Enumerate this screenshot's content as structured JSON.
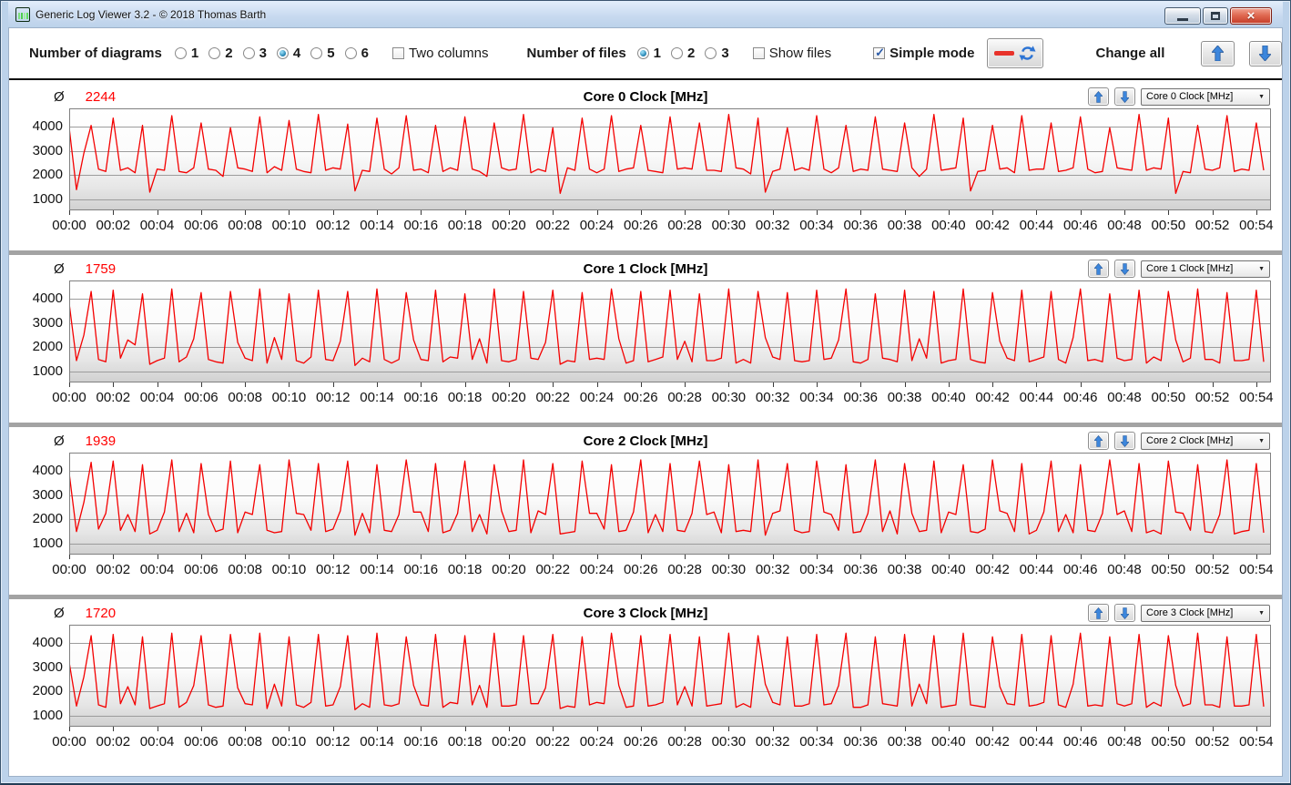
{
  "window": {
    "title": "Generic Log Viewer 3.2 - © 2018 Thomas Barth",
    "controls": [
      "minimize",
      "maximize",
      "close"
    ]
  },
  "toolbar": {
    "diagrams": {
      "label": "Number of diagrams",
      "options": [
        "1",
        "2",
        "3",
        "4",
        "5",
        "6"
      ],
      "selected": "4"
    },
    "two_columns": {
      "label": "Two columns",
      "checked": false
    },
    "files": {
      "label": "Number of files",
      "options": [
        "1",
        "2",
        "3"
      ],
      "selected": "1"
    },
    "show_files": {
      "label": "Show files",
      "checked": false
    },
    "simple_mode": {
      "label": "Simple mode",
      "checked": true
    },
    "refresh_button": {
      "icons": [
        "red-line-icon",
        "refresh-icon"
      ]
    },
    "change_all": {
      "label": "Change all",
      "buttons": [
        "up",
        "down"
      ]
    }
  },
  "labels": {
    "average_symbol": "Ø"
  },
  "colors": {
    "series": "#f40000",
    "average_value": "#ff0000",
    "grid": "#9c9c9c",
    "plot_border": "#808080",
    "separator": "#a3a3a3"
  },
  "axes": {
    "y_ticks": [
      4000,
      3000,
      2000,
      1000
    ],
    "x_tick_labels": [
      "00:00",
      "00:02",
      "00:04",
      "00:06",
      "00:08",
      "00:10",
      "00:12",
      "00:14",
      "00:16",
      "00:18",
      "00:20",
      "00:22",
      "00:24",
      "00:26",
      "00:28",
      "00:30",
      "00:32",
      "00:34",
      "00:36",
      "00:38",
      "00:40",
      "00:42",
      "00:44",
      "00:46",
      "00:48",
      "00:50",
      "00:52",
      "00:54"
    ],
    "x_tick_interval_seconds": 120,
    "x_total_seconds": 3280
  },
  "chart_data": [
    {
      "type": "line",
      "title": "Core 0 Clock [MHz]",
      "dropdown_value": "Core 0 Clock [MHz]",
      "average": 2244,
      "ylabel": "MHz",
      "ylim": [
        550,
        4750
      ],
      "y_ticks": [
        1000,
        2000,
        3000,
        4000
      ],
      "legend": "none",
      "grid": true,
      "sample_interval_s": 20,
      "values": [
        3950,
        1400,
        2900,
        4050,
        2250,
        2150,
        4350,
        2200,
        2300,
        2100,
        4050,
        1300,
        2250,
        2200,
        4450,
        2150,
        2100,
        2300,
        4150,
        2250,
        2200,
        1950,
        3950,
        2300,
        2250,
        2150,
        4400,
        2100,
        2350,
        2200,
        4250,
        2250,
        2150,
        2100,
        4500,
        2200,
        2300,
        2250,
        4100,
        1350,
        2200,
        2150,
        4350,
        2250,
        2050,
        2300,
        4450,
        2200,
        2250,
        2100,
        4050,
        2150,
        2300,
        2200,
        4400,
        2250,
        2150,
        1950,
        4150,
        2300,
        2200,
        2250,
        4500,
        2100,
        2250,
        2150,
        3950,
        1250,
        2300,
        2200,
        4350,
        2250,
        2100,
        2250,
        4450,
        2150,
        2250,
        2300,
        4050,
        2200,
        2150,
        2100,
        4400,
        2250,
        2300,
        2250,
        4150,
        2200,
        2200,
        2150,
        4500,
        2300,
        2250,
        2050,
        4350,
        1300,
        2150,
        2250,
        3950,
        2200,
        2300,
        2200,
        4450,
        2250,
        2100,
        2300,
        4050,
        2150,
        2250,
        2200,
        4400,
        2250,
        2200,
        2150,
        4150,
        2300,
        1950,
        2250,
        4500,
        2200,
        2250,
        2300,
        4350,
        1350,
        2150,
        2200,
        4050,
        2250,
        2300,
        2100,
        4450,
        2200,
        2250,
        2250,
        4150,
        2150,
        2200,
        2300,
        4400,
        2250,
        2100,
        2150,
        3950,
        2300,
        2250,
        2200,
        4500,
        2200,
        2300,
        2250,
        4350,
        1250,
        2150,
        2100,
        4050,
        2250,
        2200,
        2300,
        4450,
        2150,
        2250,
        2200,
        4150,
        2200
      ]
    },
    {
      "type": "line",
      "title": "Core 1 Clock [MHz]",
      "dropdown_value": "Core 1 Clock [MHz]",
      "average": 1759,
      "ylabel": "MHz",
      "ylim": [
        550,
        4750
      ],
      "y_ticks": [
        1000,
        2000,
        3000,
        4000
      ],
      "legend": "none",
      "grid": true,
      "sample_interval_s": 20,
      "values": [
        3800,
        1450,
        2500,
        4300,
        1500,
        1400,
        4350,
        1550,
        2300,
        2100,
        4200,
        1300,
        1450,
        1550,
        4400,
        1400,
        1600,
        2350,
        4250,
        1500,
        1400,
        1350,
        4300,
        2200,
        1550,
        1450,
        4400,
        1350,
        2400,
        1500,
        4200,
        1450,
        1350,
        1600,
        4350,
        1500,
        1450,
        2250,
        4300,
        1250,
        1550,
        1400,
        4400,
        1500,
        1350,
        1500,
        4250,
        2300,
        1500,
        1450,
        4350,
        1400,
        1600,
        1550,
        4200,
        1500,
        2350,
        1350,
        4400,
        1450,
        1400,
        1500,
        4300,
        1550,
        1500,
        2200,
        4350,
        1300,
        1450,
        1400,
        4250,
        1500,
        1550,
        1500,
        4400,
        2350,
        1350,
        1450,
        4300,
        1400,
        1500,
        1600,
        4350,
        1500,
        2250,
        1400,
        4200,
        1450,
        1450,
        1550,
        4400,
        1350,
        1500,
        1350,
        4300,
        2400,
        1600,
        1500,
        4250,
        1450,
        1400,
        1450,
        4350,
        1500,
        1550,
        2300,
        4400,
        1400,
        1350,
        1500,
        4200,
        1550,
        1500,
        1400,
        4350,
        1450,
        2350,
        1550,
        4300,
        1350,
        1450,
        1500,
        4400,
        1500,
        1400,
        1350,
        4250,
        2250,
        1550,
        1450,
        4350,
        1400,
        1500,
        1600,
        4300,
        1500,
        1350,
        2400,
        4400,
        1450,
        1500,
        1400,
        4200,
        1550,
        1450,
        1500,
        4350,
        1350,
        1600,
        1450,
        4300,
        2300,
        1400,
        1550,
        4400,
        1500,
        1500,
        1350,
        4250,
        1450,
        1450,
        1500,
        4350,
        1400
      ]
    },
    {
      "type": "line",
      "title": "Core 2 Clock [MHz]",
      "dropdown_value": "Core 2 Clock [MHz]",
      "average": 1939,
      "ylabel": "MHz",
      "ylim": [
        550,
        4750
      ],
      "y_ticks": [
        1000,
        2000,
        3000,
        4000
      ],
      "legend": "none",
      "grid": true,
      "sample_interval_s": 20,
      "values": [
        3900,
        1500,
        2700,
        4350,
        1600,
        2250,
        4400,
        1550,
        2200,
        1500,
        4250,
        1400,
        1550,
        2300,
        4450,
        1500,
        2250,
        1450,
        4300,
        2200,
        1500,
        1600,
        4400,
        1450,
        2300,
        2200,
        4250,
        1550,
        1450,
        1500,
        4450,
        2250,
        2200,
        1550,
        4300,
        1500,
        1600,
        2350,
        4400,
        1350,
        2250,
        1450,
        4250,
        1550,
        1500,
        2200,
        4450,
        2300,
        2300,
        1500,
        4300,
        1450,
        1550,
        2250,
        4400,
        1500,
        2200,
        1400,
        4250,
        2350,
        1500,
        1550,
        4450,
        1450,
        2350,
        2200,
        4300,
        1400,
        1450,
        1500,
        4400,
        2250,
        2250,
        1600,
        4250,
        1500,
        1550,
        2300,
        4450,
        1450,
        2200,
        1500,
        4300,
        1550,
        1500,
        2250,
        4400,
        2200,
        2300,
        1450,
        4250,
        1500,
        1550,
        1500,
        4450,
        1350,
        2250,
        2350,
        4300,
        1550,
        1450,
        1500,
        4400,
        2300,
        2200,
        1550,
        4250,
        1450,
        1500,
        2250,
        4450,
        1500,
        2350,
        1400,
        4300,
        2250,
        1500,
        1550,
        4400,
        1450,
        2300,
        2200,
        4250,
        1500,
        1450,
        1600,
        4450,
        2350,
        2250,
        1500,
        4300,
        1400,
        1550,
        2300,
        4400,
        1500,
        2200,
        1450,
        4250,
        1550,
        1500,
        2250,
        4450,
        2200,
        2350,
        1500,
        4300,
        1450,
        1550,
        1400,
        4400,
        2300,
        2250,
        1550,
        4250,
        1500,
        1450,
        2200,
        4450,
        1400,
        1500,
        1550,
        4300,
        1450
      ]
    },
    {
      "type": "line",
      "title": "Core 3 Clock [MHz]",
      "dropdown_value": "Core 3 Clock [MHz]",
      "average": 1720,
      "ylabel": "MHz",
      "ylim": [
        550,
        4750
      ],
      "y_ticks": [
        1000,
        2000,
        3000,
        4000
      ],
      "legend": "none",
      "grid": true,
      "sample_interval_s": 20,
      "values": [
        3200,
        1400,
        2600,
        4300,
        1450,
        1350,
        4350,
        1500,
        2200,
        1450,
        4250,
        1300,
        1400,
        1500,
        4400,
        1350,
        1550,
        2250,
        4300,
        1450,
        1350,
        1400,
        4350,
        2150,
        1500,
        1450,
        4400,
        1300,
        2300,
        1400,
        4250,
        1450,
        1350,
        1550,
        4350,
        1400,
        1450,
        2200,
        4300,
        1250,
        1500,
        1350,
        4400,
        1450,
        1400,
        1500,
        4250,
        2250,
        1450,
        1400,
        4350,
        1350,
        1550,
        1500,
        4300,
        1450,
        2250,
        1350,
        4400,
        1400,
        1400,
        1450,
        4300,
        1500,
        1500,
        2150,
        4350,
        1300,
        1400,
        1350,
        4250,
        1450,
        1550,
        1500,
        4400,
        2250,
        1350,
        1400,
        4300,
        1400,
        1450,
        1550,
        4350,
        1450,
        2200,
        1400,
        4250,
        1400,
        1450,
        1500,
        4400,
        1350,
        1500,
        1350,
        4300,
        2300,
        1550,
        1450,
        4250,
        1400,
        1400,
        1500,
        4350,
        1450,
        1500,
        2250,
        4400,
        1350,
        1350,
        1450,
        4250,
        1500,
        1450,
        1400,
        4350,
        1400,
        2300,
        1500,
        4300,
        1350,
        1400,
        1450,
        4400,
        1450,
        1400,
        1350,
        4250,
        2200,
        1500,
        1450,
        4350,
        1400,
        1450,
        1550,
        4300,
        1450,
        1350,
        2300,
        4400,
        1400,
        1450,
        1400,
        4250,
        1500,
        1400,
        1500,
        4350,
        1350,
        1550,
        1400,
        4300,
        2250,
        1400,
        1500,
        4400,
        1450,
        1450,
        1350,
        4250,
        1400,
        1400,
        1450,
        4350,
        1380
      ]
    }
  ]
}
